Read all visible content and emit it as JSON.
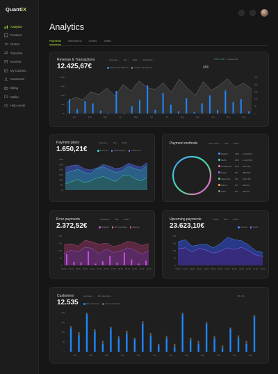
{
  "app": {
    "logo_main": "Quanti",
    "logo_accent": "X"
  },
  "sidebar": {
    "items": [
      {
        "label": "Analytics",
        "icon": "chart-icon",
        "active": true
      },
      {
        "label": "Products",
        "icon": "box-icon",
        "active": false
      },
      {
        "label": "Orders",
        "icon": "cart-icon",
        "active": false
      },
      {
        "label": "Transfers",
        "icon": "transfer-icon",
        "active": false
      },
      {
        "label": "Invoices",
        "icon": "invoice-icon",
        "active": false
      },
      {
        "label": "My Courses",
        "icon": "book-icon",
        "active": false
      },
      {
        "label": "Customers",
        "icon": "users-icon",
        "active": false
      },
      {
        "label": "Billing",
        "icon": "card-icon",
        "active": false
      },
      {
        "label": "Wallet",
        "icon": "wallet-icon",
        "active": false
      },
      {
        "label": "Help center",
        "icon": "help-icon",
        "active": false
      }
    ]
  },
  "header": {
    "title": "Analytics",
    "tabs": [
      "Payments",
      "Interactions",
      "Orders",
      "Traffic"
    ],
    "active_tab": "Payments"
  },
  "revenue": {
    "title": "Revenue & Transactions",
    "value": "12.425,67€",
    "filters": [
      "Last year",
      "Net",
      "EUR",
      "Worldwide"
    ],
    "legend": [
      "Revenue 19.425,67 €",
      "Unspent 23.433,34 €"
    ],
    "counter": "456",
    "stats": [
      "5.7%",
      "1.0%",
      "1 Unspent 45"
    ]
  },
  "payment_plans": {
    "title": "Payment plans",
    "value": "1.650,21€",
    "filters": [
      "Last year",
      "Net",
      "EUR"
    ],
    "legend": [
      "Free plan",
      "Subscriptions",
      "Investment"
    ]
  },
  "payment_methods": {
    "title": "Payment methods",
    "filters": [
      "This month",
      "Net",
      "EUR"
    ],
    "rows": [
      {
        "name": "PayPal",
        "pct": "45%",
        "amount": "2.233,65 €",
        "color": "#4b8bff"
      },
      {
        "name": "SEPA",
        "pct": "25%",
        "amount": "1.232,50 €",
        "color": "#3fd6c4"
      },
      {
        "name": "Credit Card",
        "pct": "10%",
        "amount": "933,75 €",
        "color": "#e07ab5"
      },
      {
        "name": "Sofort",
        "pct": "5%",
        "amount": "456,30 €",
        "color": "#8e6cff"
      },
      {
        "name": "Apple Pay",
        "pct": "5%",
        "amount": "194,13 €",
        "color": "#5fd38f"
      },
      {
        "name": "Klarna",
        "pct": "5%",
        "amount": "45,90 €",
        "color": "#f3a548"
      },
      {
        "name": "Other",
        "pct": "5%",
        "amount": "45,90 €",
        "color": "#888888"
      }
    ]
  },
  "error_payments": {
    "title": "Error payments",
    "value": "2.372,52€",
    "filters": [
      "Yesterday",
      "Net",
      "EUR"
    ],
    "legend": [
      "Dropped",
      "Not completed",
      "Expired"
    ]
  },
  "upcoming_payments": {
    "title": "Upcoming payments",
    "value": "23.623,10€",
    "filters": [
      "Today",
      "Net",
      "EUR"
    ],
    "legend": [
      "Amount",
      "Count"
    ]
  },
  "customers": {
    "title": "Customers",
    "value": "12.535",
    "filters": [
      "Last year",
      "All customers"
    ],
    "legend": [
      "New customers",
      "Same customers"
    ],
    "stats": [
      "2%",
      "1%"
    ]
  },
  "colors": {
    "accent": "#b6f23a",
    "blue": "#1f87ff",
    "teal": "#2a7a7a",
    "purple": "#5a3fa0",
    "pink": "#9b3a6a"
  },
  "chart_data": [
    {
      "type": "bar",
      "name": "revenue",
      "categories": [
        "Jan",
        "Feb",
        "Mar",
        "Apr",
        "May",
        "Jun",
        "Jul",
        "Aug",
        "Sep",
        "Oct",
        "Nov",
        "Dec"
      ],
      "yticks": [
        "200k",
        "150k",
        "100k",
        "50k",
        "0k"
      ],
      "yticks_right": [
        "250",
        "200",
        "150",
        "100",
        "50",
        "0"
      ],
      "series": [
        {
          "values": [
            40,
            12,
            34,
            28,
            8,
            2,
            62,
            2,
            20,
            38,
            78,
            10,
            56,
            24,
            6,
            42,
            4,
            28,
            50,
            10,
            64,
            32,
            40,
            6
          ]
        }
      ],
      "ylim": [
        0,
        100
      ]
    },
    {
      "type": "area",
      "name": "payment_plans",
      "yticks": [
        "300k",
        "250k",
        "200k",
        "150k",
        "100k",
        "50k",
        "0k"
      ],
      "series": [
        {
          "values": [
            75,
            80,
            82,
            70,
            66,
            72,
            84,
            78,
            70,
            74,
            88,
            80,
            76,
            90
          ]
        },
        {
          "values": [
            55,
            62,
            68,
            58,
            52,
            70,
            76,
            66,
            58,
            62,
            78,
            70,
            64,
            80
          ]
        },
        {
          "values": [
            20,
            28,
            35,
            24,
            30,
            40,
            44,
            36,
            28,
            46,
            50,
            38,
            30,
            42
          ]
        }
      ],
      "ylim": [
        0,
        100
      ]
    },
    {
      "type": "area",
      "name": "error_payments",
      "categories": [
        "00:00",
        "01:00",
        "02:00",
        "03:00",
        "04:00",
        "05:00",
        "06:00",
        "07:00",
        "08:00",
        "09:00",
        "10:00",
        "11:00",
        "12:00"
      ],
      "yticks": [
        "200",
        "150",
        "100",
        "50",
        "0"
      ],
      "series": [
        {
          "values": [
            70,
            74,
            66,
            86,
            80,
            72,
            76,
            64,
            70,
            82,
            78,
            68,
            74
          ]
        },
        {
          "values": [
            40,
            52,
            46,
            62,
            58,
            40,
            56,
            44,
            48,
            60,
            52,
            38,
            50
          ]
        }
      ],
      "bars": [
        38,
        12,
        10,
        48,
        6,
        14,
        32,
        10,
        44,
        20,
        6,
        16
      ],
      "ylim": [
        0,
        100
      ]
    },
    {
      "type": "area",
      "name": "upcoming_payments",
      "categories": [
        "00:00",
        "01:00",
        "02:00",
        "03:00",
        "04:00",
        "05:00",
        "06:00",
        "07:00",
        "08:00",
        "09:00",
        "10:00",
        "11:00",
        "12:00"
      ],
      "yticks": [
        "200",
        "150",
        "100",
        "50",
        "0"
      ],
      "series": [
        {
          "values": [
            80,
            88,
            66,
            70,
            72,
            60,
            74,
            96,
            88,
            84,
            70,
            50,
            44
          ]
        },
        {
          "values": [
            56,
            60,
            46,
            58,
            52,
            42,
            48,
            60,
            54,
            62,
            50,
            36,
            30
          ]
        }
      ],
      "ylim": [
        0,
        100
      ]
    },
    {
      "type": "bar",
      "name": "customers",
      "categories": [
        "Jan",
        "Feb",
        "Mar",
        "Apr",
        "May",
        "Jun",
        "Jul",
        "Aug",
        "Sep",
        "Oct",
        "Nov",
        "Dec"
      ],
      "yticks": [
        "200",
        "150",
        "100",
        "50",
        "0"
      ],
      "series": [
        {
          "name": "New customers",
          "values": [
            60,
            42,
            96,
            52,
            20,
            60,
            34,
            46,
            32,
            72,
            40,
            16,
            34,
            12,
            96,
            30,
            20,
            72,
            34,
            8,
            58,
            36,
            20,
            90
          ]
        },
        {
          "name": "Same customers",
          "values": [
            6,
            8,
            4,
            6,
            8,
            4,
            6,
            8,
            4,
            6,
            8,
            4,
            6,
            8,
            4,
            6,
            8,
            4,
            6,
            8,
            4,
            6,
            8,
            4
          ]
        }
      ],
      "ylim": [
        0,
        100
      ]
    }
  ]
}
